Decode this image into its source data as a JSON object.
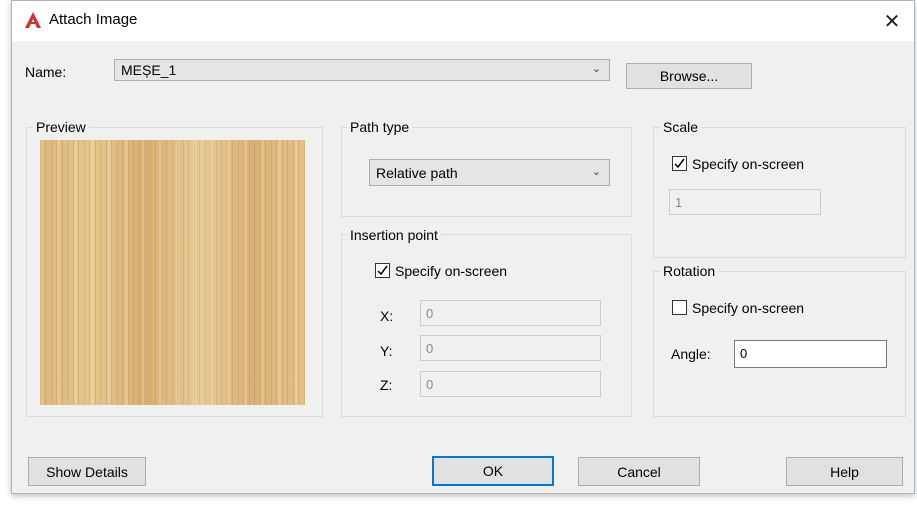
{
  "window": {
    "title": "Attach Image",
    "close_glyph": "✕"
  },
  "name": {
    "label": "Name:",
    "value": "MEȘE_1",
    "browse_label": "Browse..."
  },
  "preview": {
    "title": "Preview"
  },
  "path_type": {
    "title": "Path type",
    "selected": "Relative path"
  },
  "insertion_point": {
    "title": "Insertion point",
    "specify_label": "Specify on-screen",
    "specify_checked": true,
    "x_label": "X:",
    "x_value": "0",
    "y_label": "Y:",
    "y_value": "0",
    "z_label": "Z:",
    "z_value": "0"
  },
  "scale": {
    "title": "Scale",
    "specify_label": "Specify on-screen",
    "specify_checked": true,
    "value": "1"
  },
  "rotation": {
    "title": "Rotation",
    "specify_label": "Specify on-screen",
    "specify_checked": false,
    "angle_label": "Angle:",
    "angle_value": "0"
  },
  "buttons": {
    "show_details": "Show Details",
    "ok": "OK",
    "cancel": "Cancel",
    "help": "Help"
  },
  "colors": {
    "accent": "#0078d7",
    "autocad_red": "#d32f2f"
  }
}
